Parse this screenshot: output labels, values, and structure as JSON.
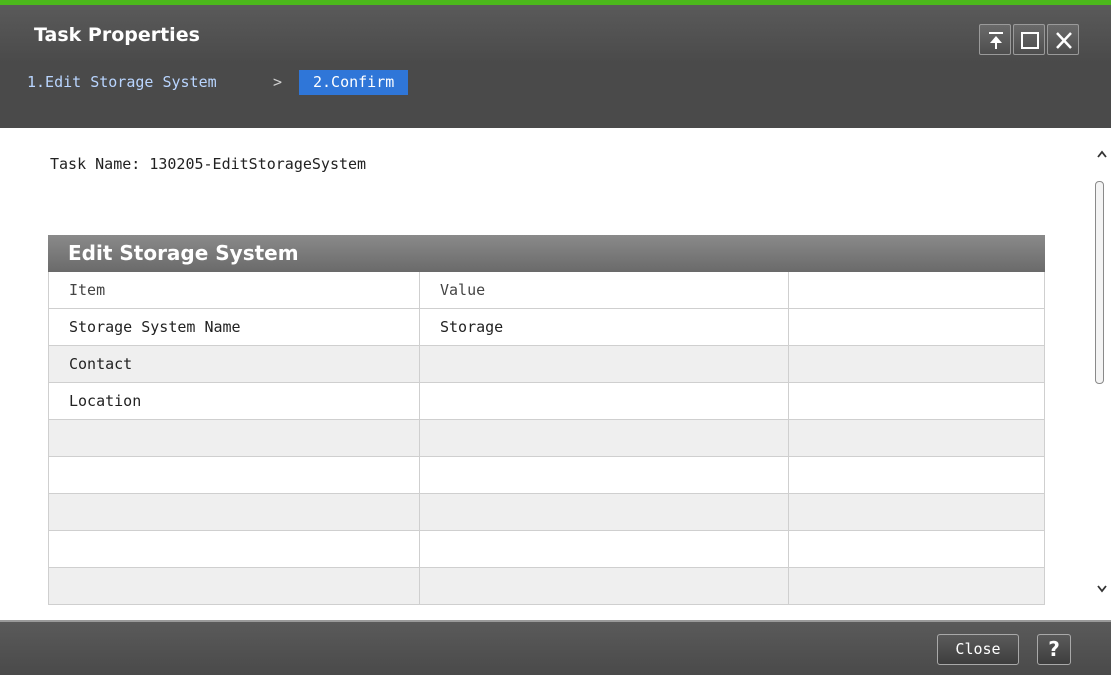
{
  "window": {
    "title": "Task Properties",
    "accent_color": "#4cb81c",
    "buttons": [
      "pin-top-icon",
      "maximize-icon",
      "close-icon"
    ]
  },
  "wizard": {
    "step1": "1.Edit Storage System",
    "separator": ">",
    "step2": "2.Confirm",
    "active_step_color": "#2f76d8"
  },
  "task": {
    "label": "Task Name: 130205-EditStorageSystem"
  },
  "table": {
    "title": "Edit Storage System",
    "columns": [
      "Item",
      "Value",
      ""
    ],
    "rows": [
      [
        "Storage System Name",
        "Storage",
        ""
      ],
      [
        "Contact",
        "",
        ""
      ],
      [
        "Location",
        "",
        ""
      ],
      [
        "",
        "",
        ""
      ],
      [
        "",
        "",
        ""
      ],
      [
        "",
        "",
        ""
      ],
      [
        "",
        "",
        ""
      ],
      [
        "",
        "",
        ""
      ]
    ]
  },
  "footer": {
    "close_label": "Close",
    "help_label": "?"
  }
}
